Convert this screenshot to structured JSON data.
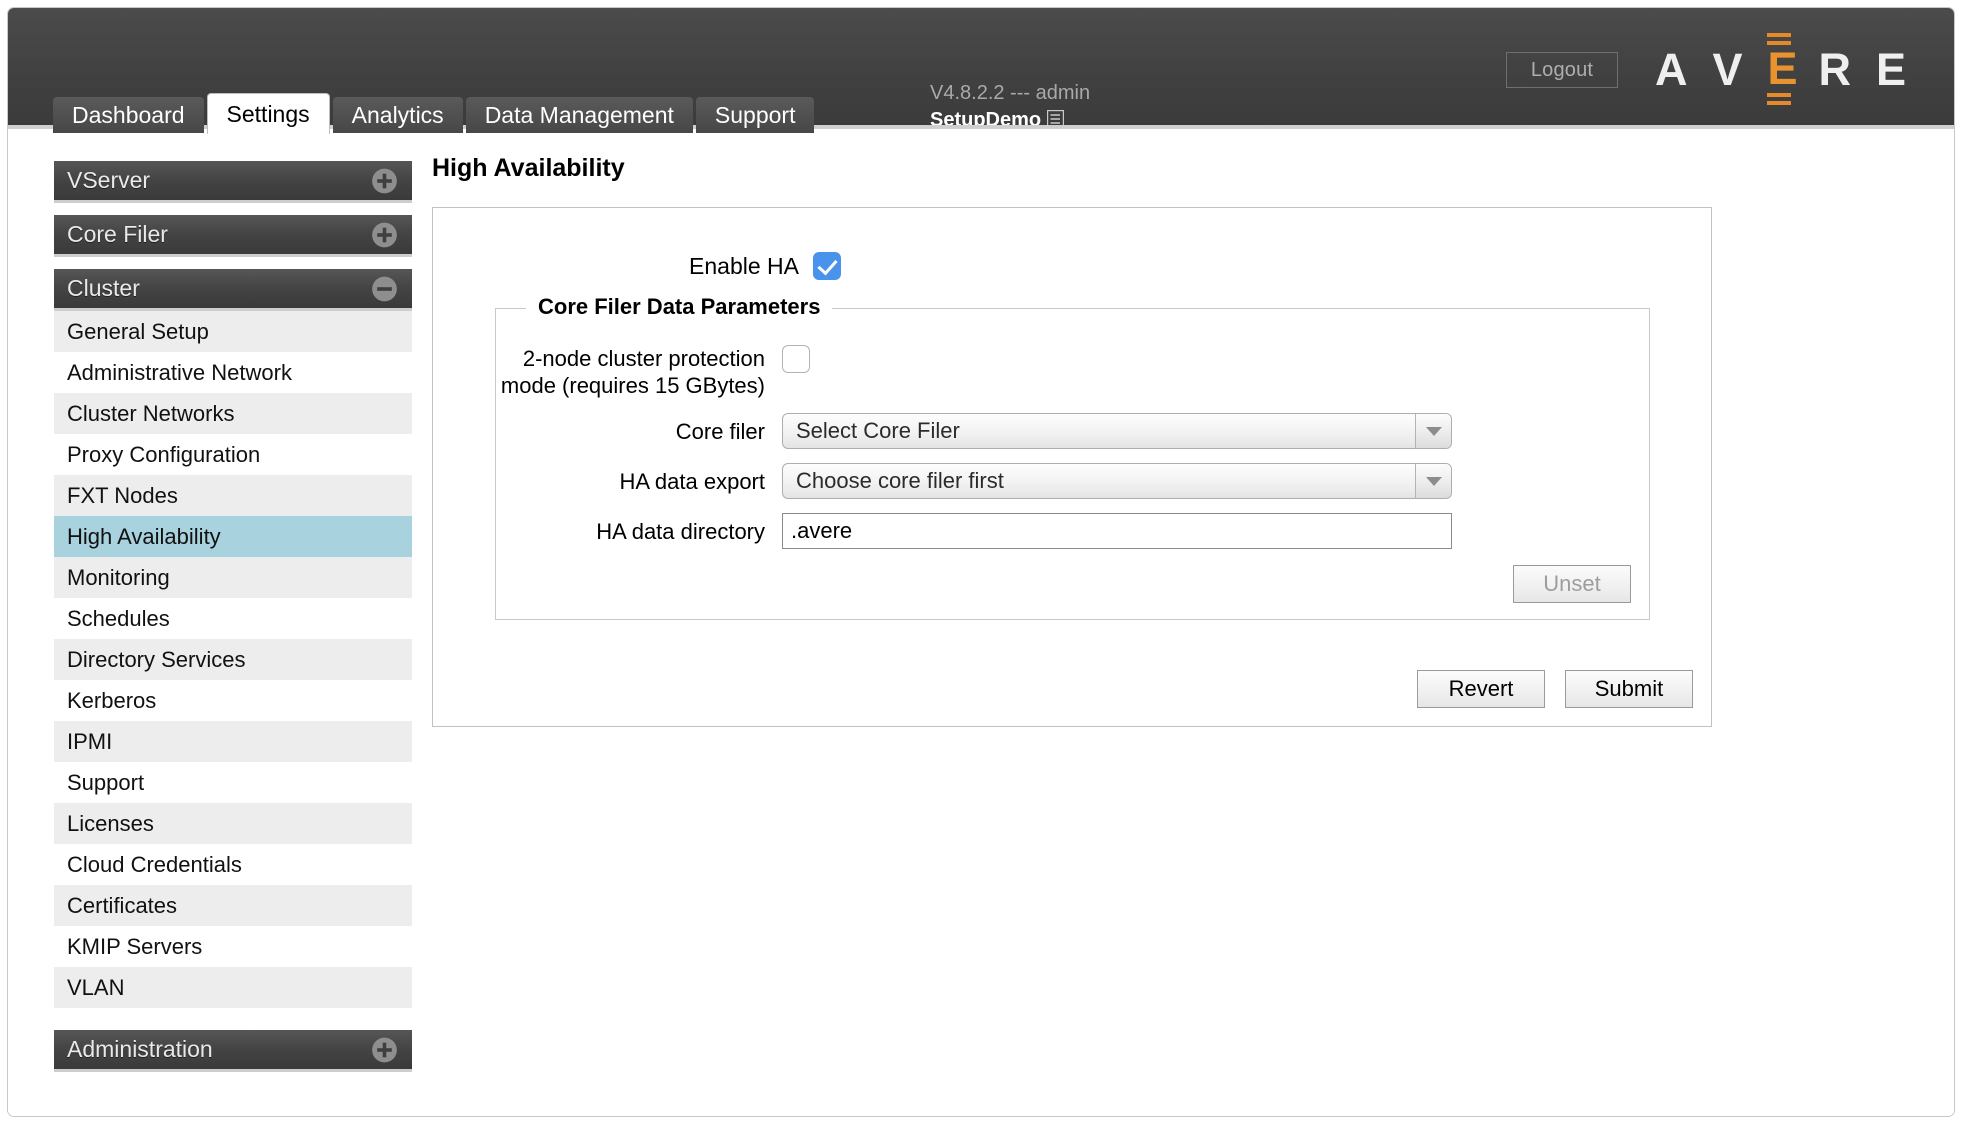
{
  "header": {
    "logout_label": "Logout",
    "version_line": "V4.8.2.2 --- admin",
    "cluster_name": "SetupDemo",
    "cluster_icon": "document-list-icon",
    "logo_letters": [
      "A",
      "V",
      "E",
      "R",
      "E"
    ],
    "logo_accent_color": "#e9932e"
  },
  "tabs": [
    {
      "label": "Dashboard",
      "active": false
    },
    {
      "label": "Settings",
      "active": true
    },
    {
      "label": "Analytics",
      "active": false
    },
    {
      "label": "Data Management",
      "active": false
    },
    {
      "label": "Support",
      "active": false
    }
  ],
  "sidebar": {
    "groups": [
      {
        "title": "VServer",
        "expanded": false,
        "toggle_icon": "plus-circle-icon",
        "items": []
      },
      {
        "title": "Core Filer",
        "expanded": false,
        "toggle_icon": "plus-circle-icon",
        "items": []
      },
      {
        "title": "Cluster",
        "expanded": true,
        "toggle_icon": "minus-circle-icon",
        "items": [
          {
            "label": "General Setup",
            "selected": false
          },
          {
            "label": "Administrative Network",
            "selected": false
          },
          {
            "label": "Cluster Networks",
            "selected": false
          },
          {
            "label": "Proxy Configuration",
            "selected": false
          },
          {
            "label": "FXT Nodes",
            "selected": false
          },
          {
            "label": "High Availability",
            "selected": true
          },
          {
            "label": "Monitoring",
            "selected": false
          },
          {
            "label": "Schedules",
            "selected": false
          },
          {
            "label": "Directory Services",
            "selected": false
          },
          {
            "label": "Kerberos",
            "selected": false
          },
          {
            "label": "IPMI",
            "selected": false
          },
          {
            "label": "Support",
            "selected": false
          },
          {
            "label": "Licenses",
            "selected": false
          },
          {
            "label": "Cloud Credentials",
            "selected": false
          },
          {
            "label": "Certificates",
            "selected": false
          },
          {
            "label": "KMIP Servers",
            "selected": false
          },
          {
            "label": "VLAN",
            "selected": false
          }
        ]
      },
      {
        "title": "Administration",
        "expanded": false,
        "toggle_icon": "plus-circle-icon",
        "items": []
      }
    ],
    "selected_color": "#a8d2de"
  },
  "main": {
    "page_title": "High Availability",
    "enable_ha": {
      "label": "Enable HA",
      "checked": true,
      "checkbox_color": "#4a93ec"
    },
    "fieldset": {
      "legend": "Core Filer Data Parameters",
      "two_node": {
        "label": "2-node cluster protection mode (requires 15 GBytes)",
        "checked": false
      },
      "core_filer": {
        "label": "Core filer",
        "value": "Select Core Filer",
        "arrow_icon": "chevron-down-icon"
      },
      "ha_data_export": {
        "label": "HA data export",
        "value": "Choose core filer first",
        "arrow_icon": "chevron-down-icon"
      },
      "ha_data_directory": {
        "label": "HA data directory",
        "value": ".avere",
        "placeholder": ""
      },
      "unset_button": {
        "label": "Unset",
        "disabled": true
      }
    },
    "actions": {
      "revert_label": "Revert",
      "submit_label": "Submit"
    }
  }
}
